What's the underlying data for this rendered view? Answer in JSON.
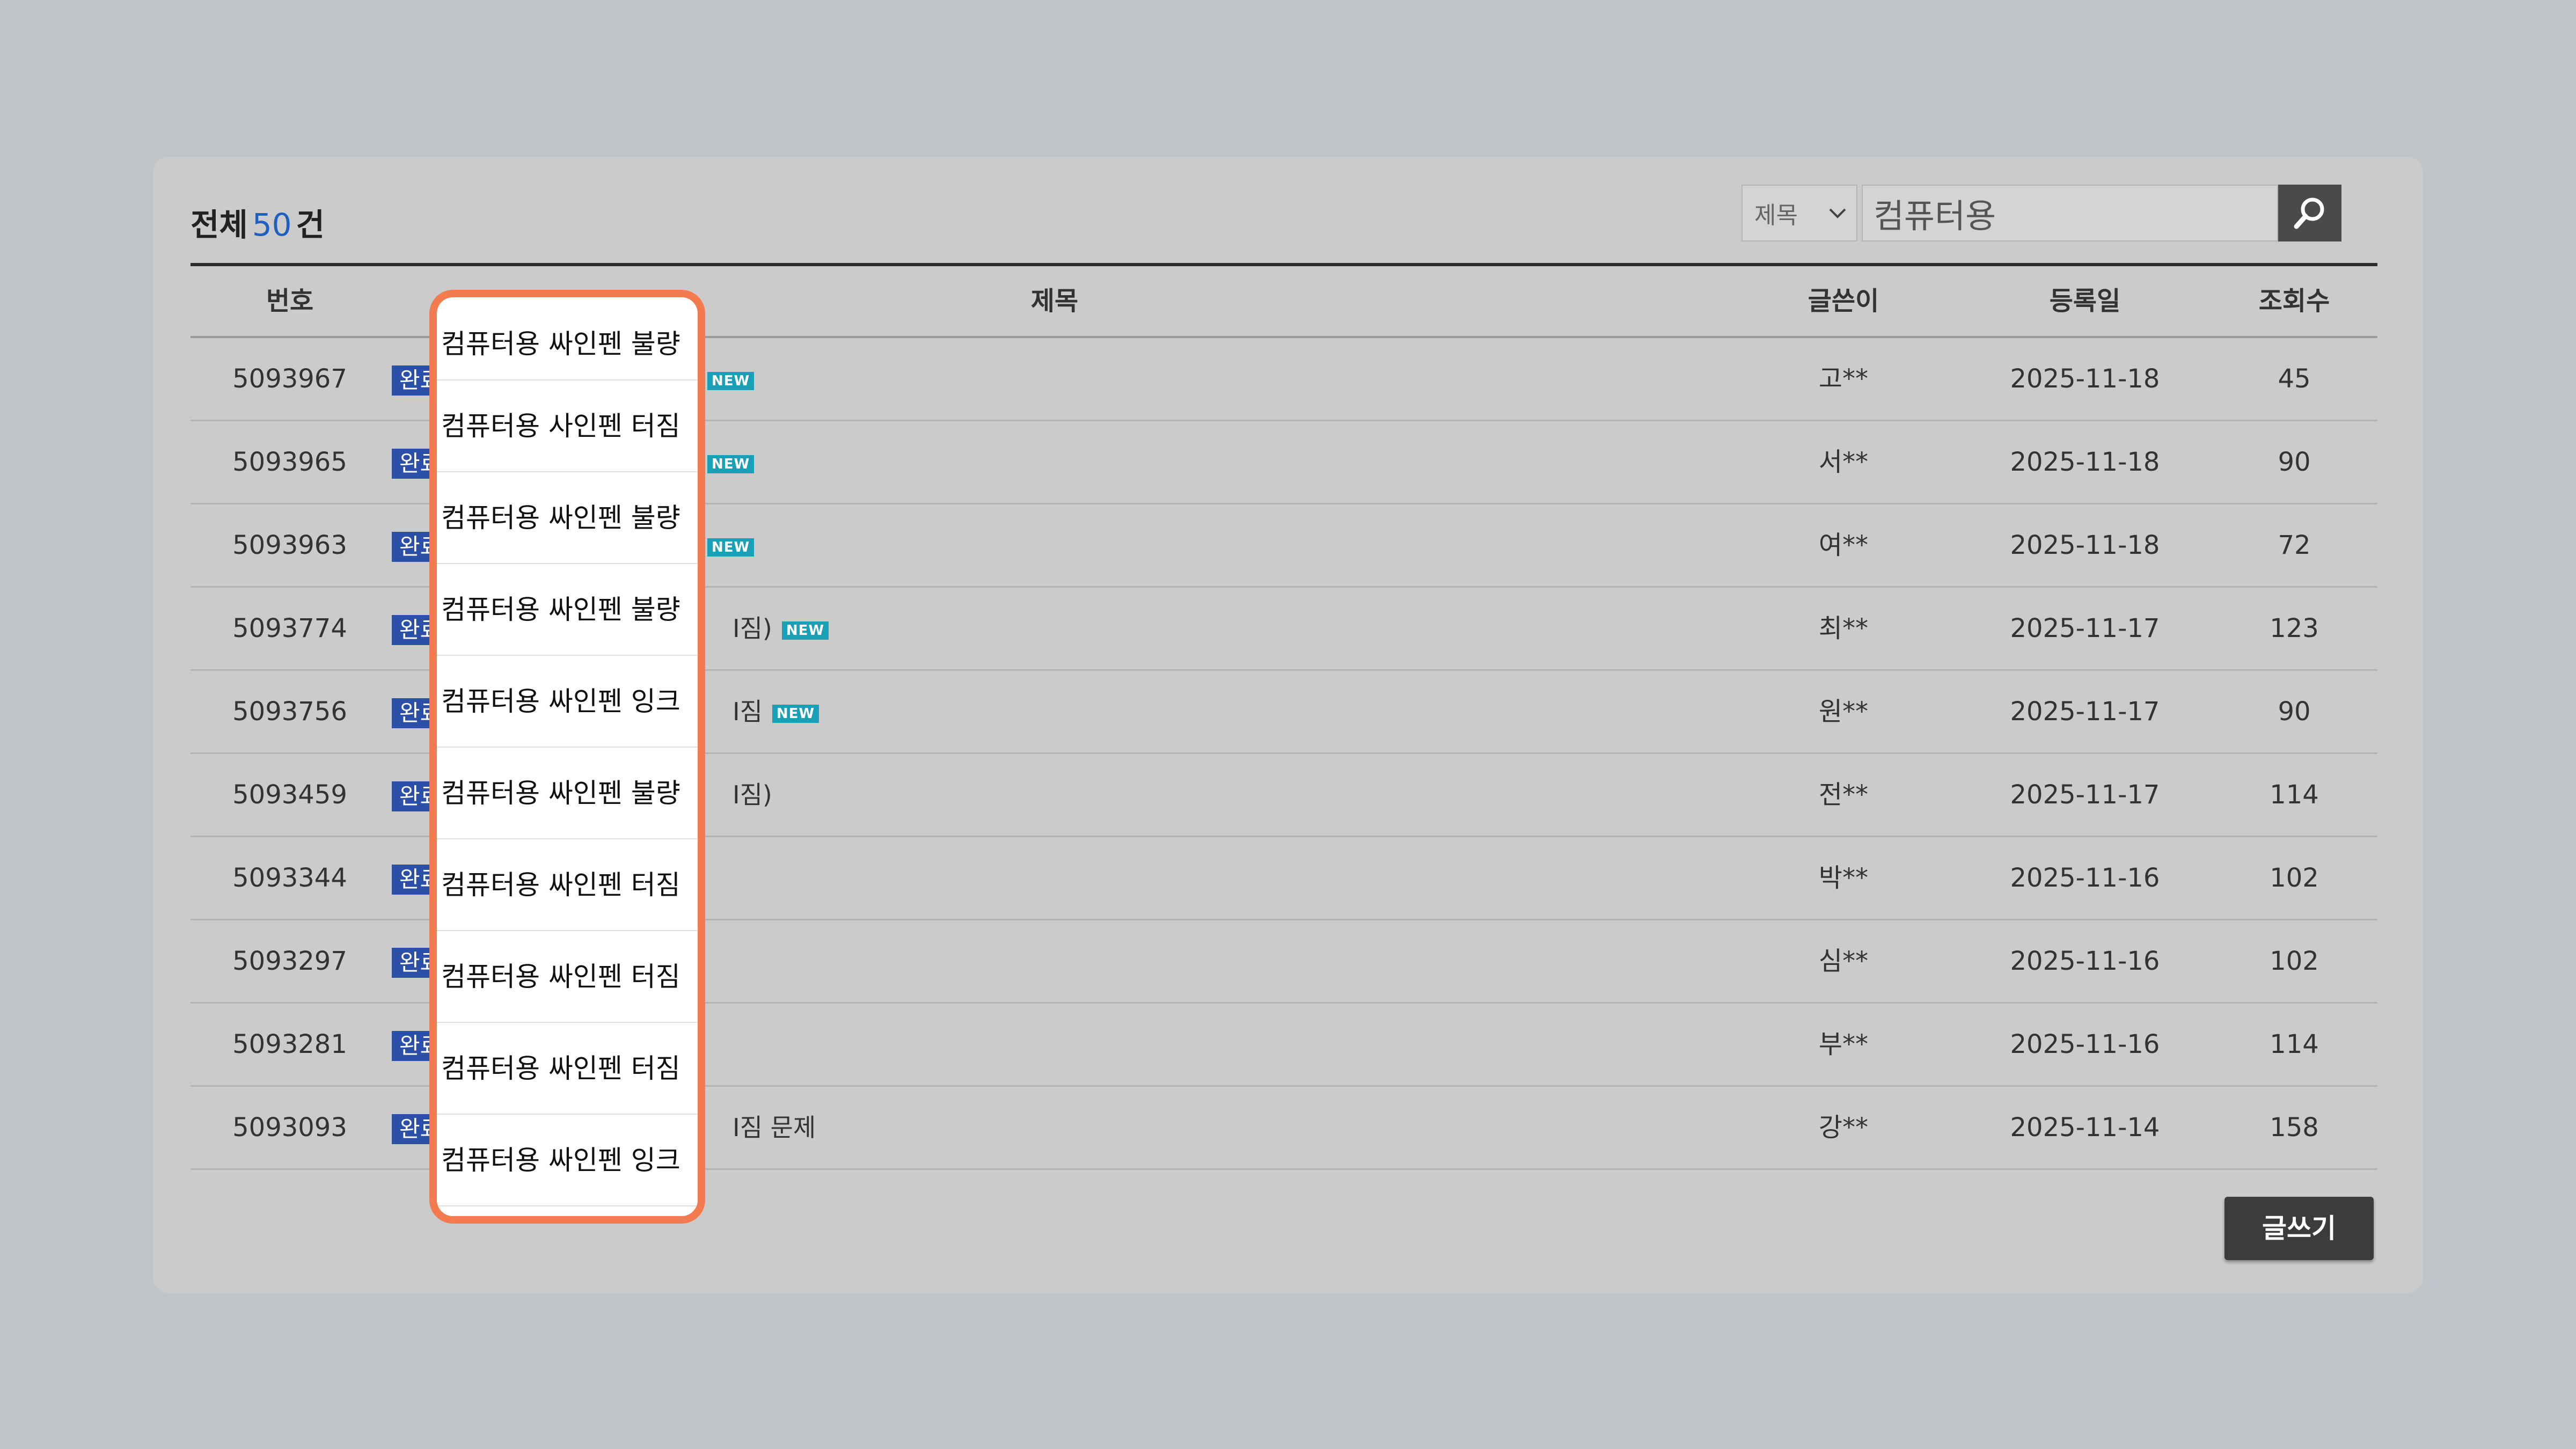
{
  "board": {
    "total_prefix": "전체",
    "total_count": "50",
    "total_suffix": "건"
  },
  "search": {
    "select_value": "제목",
    "query": "컴퓨터용",
    "icon": "search-icon"
  },
  "table": {
    "headers": {
      "no": "번호",
      "title": "제목",
      "writer": "글쓴이",
      "date": "등록일",
      "views": "조회수"
    },
    "rows": [
      {
        "no": "5093967",
        "badge": "완료",
        "title_tail": "",
        "new": "NEW",
        "writer": "고**",
        "date": "2025-11-18",
        "views": "45"
      },
      {
        "no": "5093965",
        "badge": "완료",
        "title_tail": "",
        "new": "NEW",
        "writer": "서**",
        "date": "2025-11-18",
        "views": "90"
      },
      {
        "no": "5093963",
        "badge": "완료",
        "title_tail": "",
        "new": "NEW",
        "writer": "여**",
        "date": "2025-11-18",
        "views": "72"
      },
      {
        "no": "5093774",
        "badge": "완료",
        "title_tail": "I짐)",
        "new": "NEW",
        "writer": "최**",
        "date": "2025-11-17",
        "views": "123"
      },
      {
        "no": "5093756",
        "badge": "완료",
        "title_tail": "I짐",
        "new": "NEW",
        "writer": "원**",
        "date": "2025-11-17",
        "views": "90"
      },
      {
        "no": "5093459",
        "badge": "완료",
        "title_tail": "I짐)",
        "new": "",
        "writer": "전**",
        "date": "2025-11-17",
        "views": "114"
      },
      {
        "no": "5093344",
        "badge": "완료",
        "title_tail": "",
        "new": "",
        "writer": "박**",
        "date": "2025-11-16",
        "views": "102"
      },
      {
        "no": "5093297",
        "badge": "완료",
        "title_tail": "",
        "new": "",
        "writer": "심**",
        "date": "2025-11-16",
        "views": "102"
      },
      {
        "no": "5093281",
        "badge": "완료",
        "title_tail": "",
        "new": "",
        "writer": "부**",
        "date": "2025-11-16",
        "views": "114"
      },
      {
        "no": "5093093",
        "badge": "완료",
        "title_tail": "I짐 문제",
        "new": "",
        "writer": "강**",
        "date": "2025-11-14",
        "views": "158"
      }
    ]
  },
  "popup": {
    "items": [
      "컴퓨터용 싸인펜 불량",
      "컴퓨터용 사인펜 터짐",
      "컴퓨터용 싸인펜 불량",
      "컴퓨터용 싸인펜 불량",
      "컴퓨터용 싸인펜 잉크",
      "컴퓨터용 싸인펜 불량",
      "컴퓨터용 싸인펜 터짐",
      "컴퓨터용 싸인펜 터짐",
      "컴퓨터용 싸인펜 터짐",
      "컴퓨터용 싸인펜 잉크"
    ]
  },
  "write_button": "글쓰기",
  "colors": {
    "accent": "#1f5fbf",
    "badge": "#2c4fa8",
    "new_badge": "#1aa0b6",
    "popup_border": "#f47b4f"
  }
}
